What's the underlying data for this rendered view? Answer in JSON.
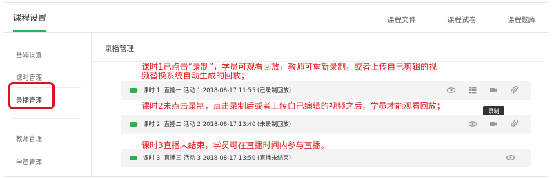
{
  "header": {
    "active_tab": "课程设置",
    "tabs": [
      "课程文件",
      "课程试卷",
      "课程题库"
    ]
  },
  "sidebar": {
    "items": [
      "基础设置",
      "课时管理",
      "录播管理",
      "教师管理",
      "学员管理"
    ]
  },
  "content": {
    "title": "录播管理",
    "rows": [
      {
        "text": "课时 1:  直播一  活动 1  2018-08-17 11:55  (已录制回放)",
        "actions": [
          "eye-icon",
          "list-icon",
          "video-camera-icon",
          "paperclip-icon"
        ]
      },
      {
        "text": "课时 2:  直播二  活动 2  2018-08-17 13:40  (未录制回放)",
        "actions": [
          "eye-icon",
          "video-camera-icon",
          "paperclip-icon"
        ]
      },
      {
        "text": "课时 3:  直播三  活动 3  2018-08-17 13:50  (直播未结束)",
        "actions": [
          "eye-icon"
        ]
      }
    ],
    "tooltip": "录制"
  },
  "annotations": {
    "a1_line1": "课时1已点击“录制”，学员可观看回放，教师可重新录制，或者上传自己剪辑的视",
    "a1_line2": "频替换系统自动生成的回放；",
    "a2": "课时2未点击录制，点击录制后或者上传自己编辑的视频之后，学员才能观看回放；",
    "a3": "课时3直播未结束，学员可在直播时间内参与直播。"
  },
  "colors": {
    "accent": "#2bb24c",
    "annotation": "#e31b1b",
    "highlight_border": "#d9131f"
  }
}
